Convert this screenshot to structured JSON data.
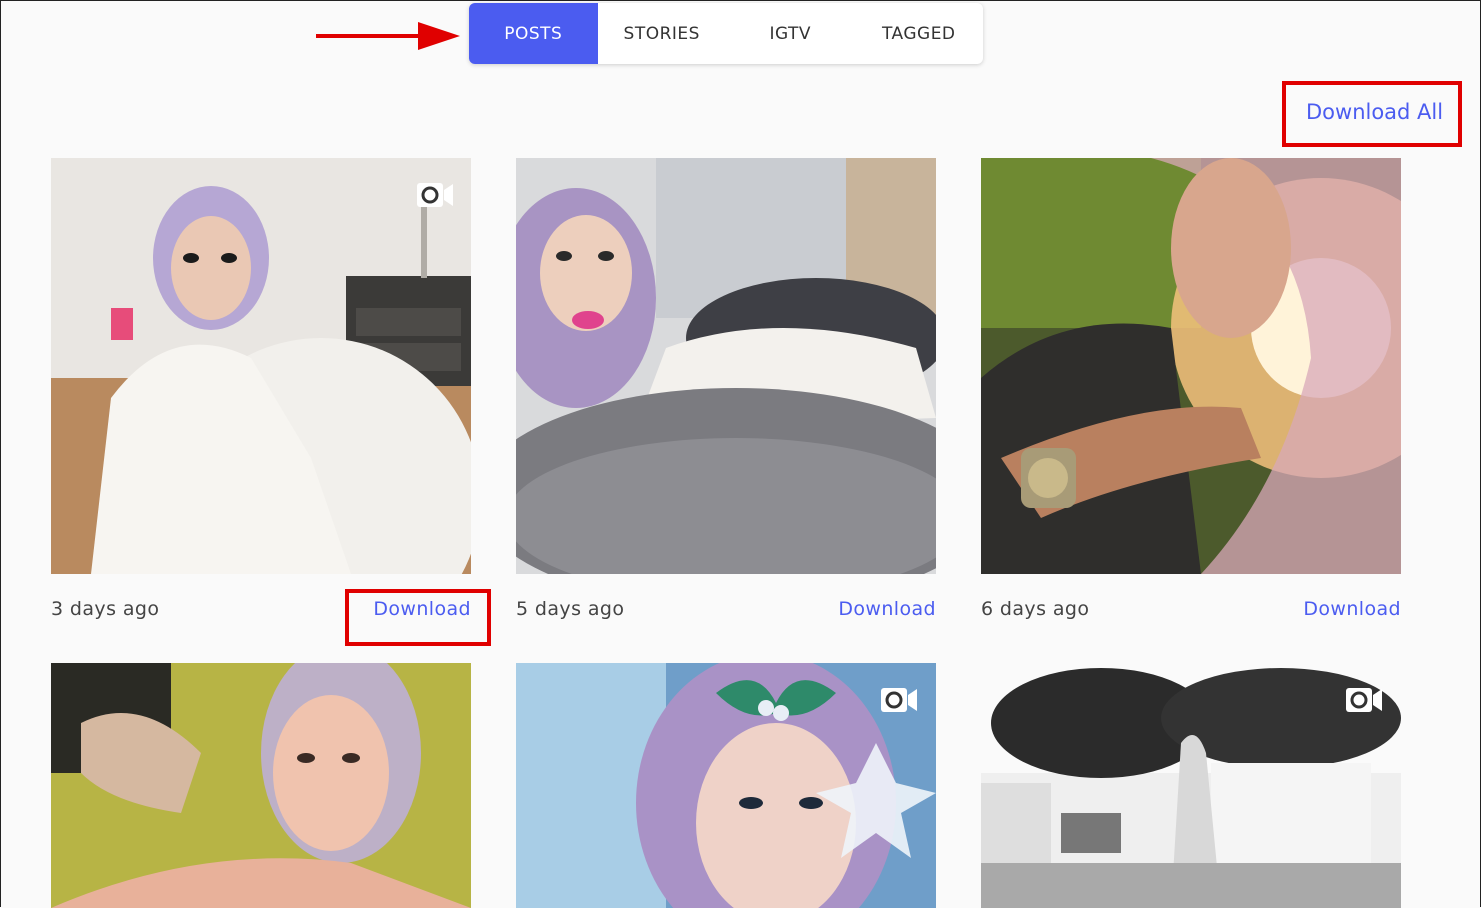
{
  "tabs": [
    {
      "label": "POSTS",
      "active": true
    },
    {
      "label": "STORIES",
      "active": false
    },
    {
      "label": "IGTV",
      "active": false
    },
    {
      "label": "TAGGED",
      "active": false
    }
  ],
  "download_all_label": "Download All",
  "posts": [
    {
      "age": "3 days ago",
      "download_label": "Download",
      "has_video_icon": true
    },
    {
      "age": "5 days ago",
      "download_label": "Download",
      "has_video_icon": false
    },
    {
      "age": "6 days ago",
      "download_label": "Download",
      "has_video_icon": false
    },
    {
      "age": "",
      "download_label": "",
      "has_video_icon": false
    },
    {
      "age": "",
      "download_label": "",
      "has_video_icon": true
    },
    {
      "age": "",
      "download_label": "",
      "has_video_icon": true
    }
  ],
  "colors": {
    "accent": "#4b5cf0",
    "highlight": "#e00000",
    "background": "#fafafa"
  }
}
